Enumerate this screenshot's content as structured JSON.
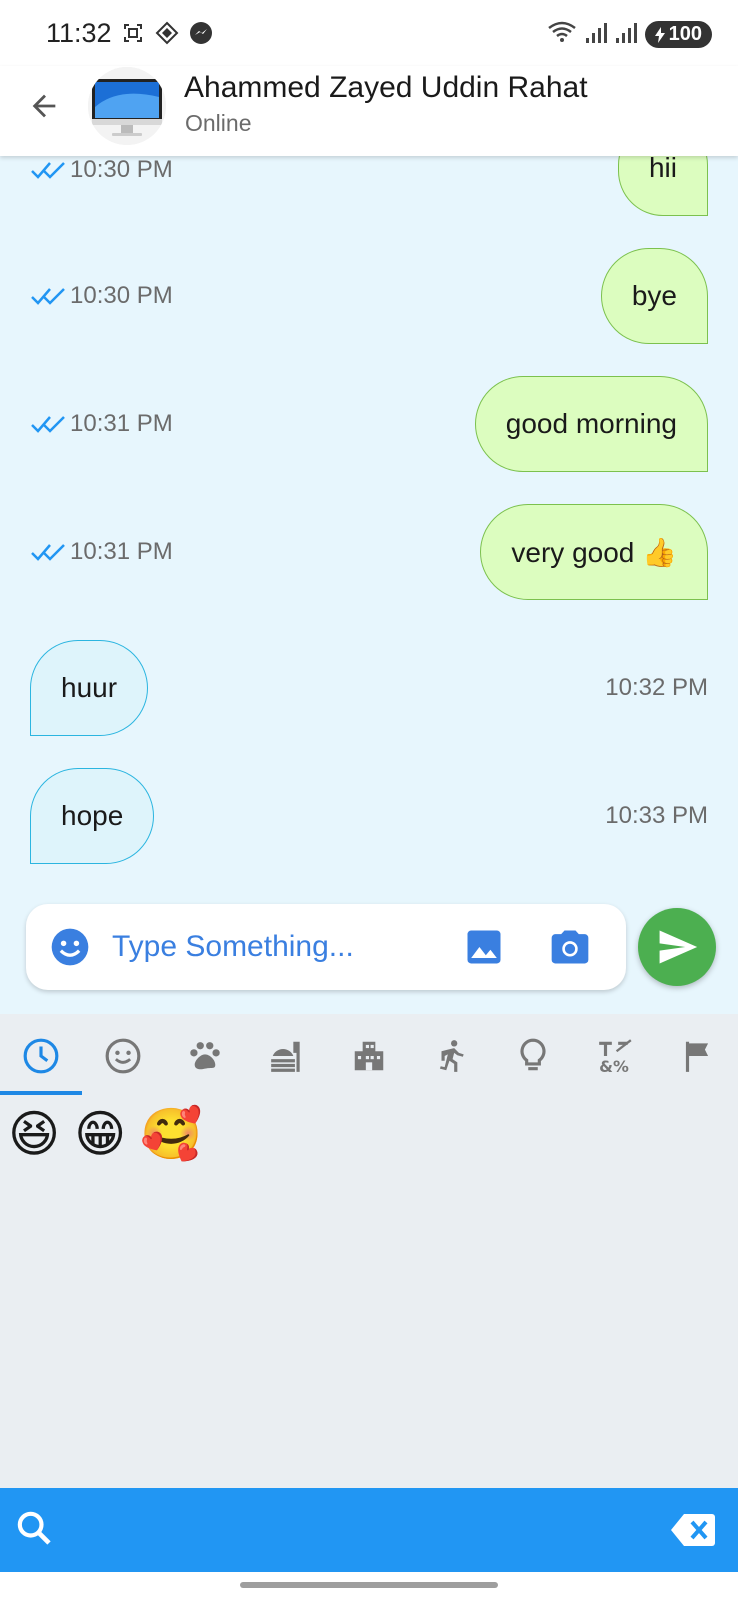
{
  "status_bar": {
    "time": "11:32",
    "battery": "100",
    "icons": [
      "screen-record-icon",
      "app-icon",
      "messenger-icon",
      "wifi-icon",
      "signal-icon",
      "signal-icon",
      "battery-icon"
    ]
  },
  "header": {
    "back_icon": "arrow-back-icon",
    "contact_name": "Ahammed Zayed Uddin Rahat",
    "contact_status": "Online"
  },
  "messages": [
    {
      "direction": "out",
      "text": "hii",
      "time": "10:30 PM",
      "read": true
    },
    {
      "direction": "out",
      "text": "bye",
      "time": "10:30 PM",
      "read": true
    },
    {
      "direction": "out",
      "text": "good morning",
      "time": "10:31 PM",
      "read": true
    },
    {
      "direction": "out",
      "text": "very good 👍",
      "time": "10:31 PM",
      "read": true
    },
    {
      "direction": "in",
      "text": "huur",
      "time": "10:32 PM"
    },
    {
      "direction": "in",
      "text": "hope",
      "time": "10:33 PM"
    }
  ],
  "input": {
    "placeholder": "Type Something...",
    "value": ""
  },
  "emoji_keyboard": {
    "tabs": [
      "recent",
      "smileys",
      "animals",
      "food",
      "travel",
      "activities",
      "objects",
      "symbols",
      "flags"
    ],
    "active_tab": "recent",
    "recent_emojis": [
      "😆",
      "😁",
      "🥰"
    ]
  },
  "colors": {
    "chat_background": "#e7f6fd",
    "outgoing_bubble": "#dcfdbf",
    "incoming_bubble": "#def4fb",
    "send_button": "#4caf50",
    "accent_blue": "#2196f3",
    "read_tick": "#2196f3"
  }
}
